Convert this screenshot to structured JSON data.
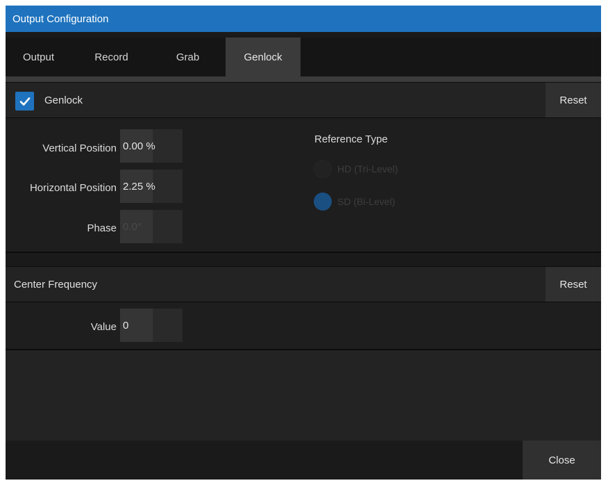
{
  "window": {
    "title": "Output Configuration"
  },
  "tabs": [
    {
      "label": "Output"
    },
    {
      "label": "Record"
    },
    {
      "label": "Grab"
    },
    {
      "label": "Genlock",
      "active": true
    }
  ],
  "genlock": {
    "enabled": true,
    "label": "Genlock",
    "reset_label": "Reset",
    "fields": {
      "vertical_position": {
        "label": "Vertical Position",
        "value": "0.00 %"
      },
      "horizontal_position": {
        "label": "Horizontal Position",
        "value": "2.25 %"
      },
      "phase": {
        "label": "Phase",
        "value": "0.0°"
      }
    },
    "reference_type": {
      "title": "Reference Type",
      "options": [
        {
          "label": "HD (Tri-Level)",
          "selected": false
        },
        {
          "label": "SD (Bi-Level)",
          "selected": true
        }
      ]
    }
  },
  "center_frequency": {
    "label": "Center Frequency",
    "reset_label": "Reset",
    "value_label": "Value",
    "value": "0"
  },
  "footer": {
    "close_label": "Close"
  },
  "colors": {
    "accent": "#1f73be",
    "background": "#1a1a1a",
    "panel": "#232323",
    "button": "#303030"
  }
}
